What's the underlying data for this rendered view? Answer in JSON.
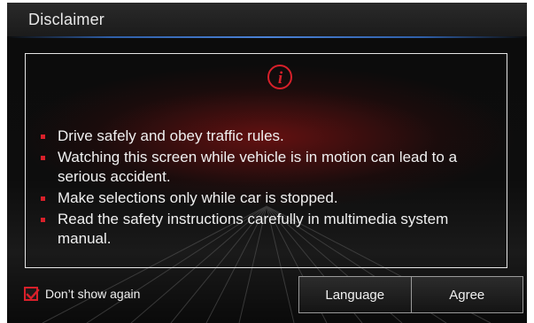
{
  "dialog": {
    "title": "Disclaimer"
  },
  "panel": {
    "icon": "info-icon",
    "bullets": [
      {
        "text": "Drive safely and obey traffic rules."
      },
      {
        "text": "Watching this screen while vehicle is in motion can lead to a serious accident."
      },
      {
        "text": "Make selections only while car is stopped."
      },
      {
        "text": "Read the safety instructions carefully in multimedia system manual."
      }
    ]
  },
  "footer": {
    "dont_show_again": {
      "label": "Don’t show again",
      "checked": true
    },
    "buttons": {
      "language": "Language",
      "agree": "Agree"
    }
  },
  "colors": {
    "accent_red": "#d8202a",
    "header_line_blue": "#4b82d6",
    "text": "#f0f0f0",
    "background": "#0c0c0c"
  }
}
